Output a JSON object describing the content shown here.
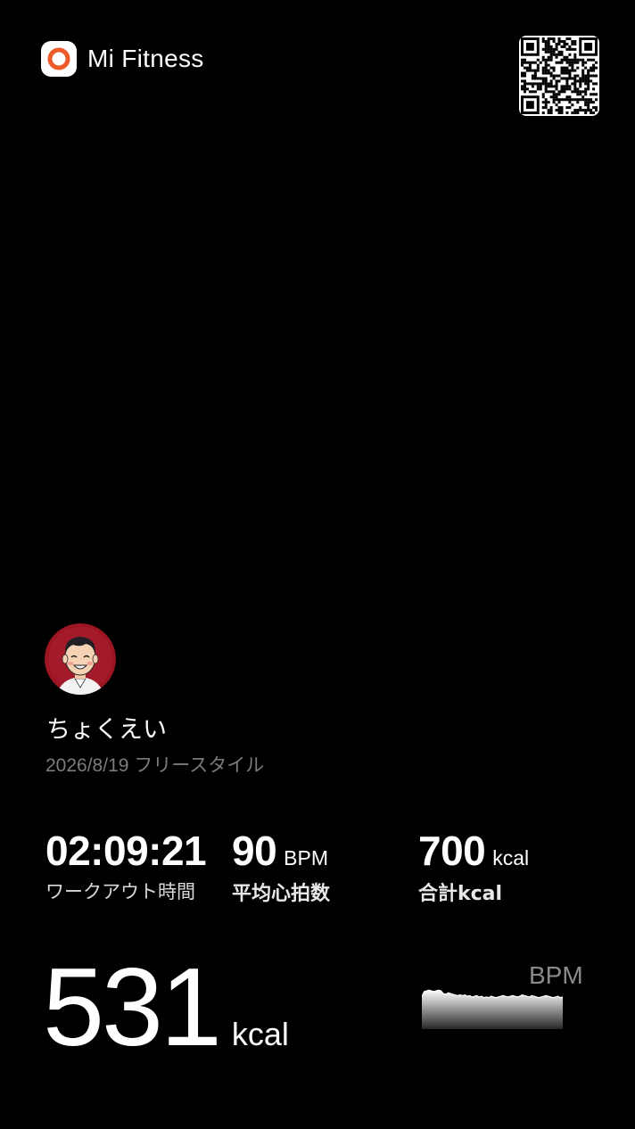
{
  "header": {
    "app_name": "Mi Fitness",
    "logo_icon": "mi-fitness-ring-icon",
    "qr_icon": "qr-code-icon",
    "accent_color": "#F05A28"
  },
  "profile": {
    "avatar_icon": "user-avatar-illustration",
    "name": "ちょくえい",
    "subtitle": "2026/8/19 フリースタイル"
  },
  "stats": [
    {
      "value": "02:09:21",
      "unit": "",
      "label": "ワークアウト時間"
    },
    {
      "value": "90",
      "unit": "BPM",
      "label": "平均心拍数"
    },
    {
      "value": "700",
      "unit": "kcal",
      "label": "合計kcal"
    }
  ],
  "calories": {
    "value": "531",
    "unit": "kcal"
  },
  "heart_rate_chart": {
    "label": "BPM",
    "chart_data": {
      "type": "area",
      "values": [
        88,
        95,
        96,
        97,
        96,
        95,
        96,
        97,
        96,
        92,
        91,
        93,
        92,
        91,
        90,
        89,
        90,
        89,
        90,
        88,
        89,
        87,
        88,
        89,
        87,
        88,
        86,
        87,
        86,
        88,
        87,
        86,
        87,
        88,
        89,
        88,
        87,
        88,
        89,
        88,
        87,
        88,
        90,
        89,
        88,
        87,
        89,
        88,
        87,
        86,
        87,
        88,
        89,
        88,
        87,
        86,
        87,
        88,
        86,
        87
      ],
      "ylim": [
        40,
        100
      ]
    }
  }
}
